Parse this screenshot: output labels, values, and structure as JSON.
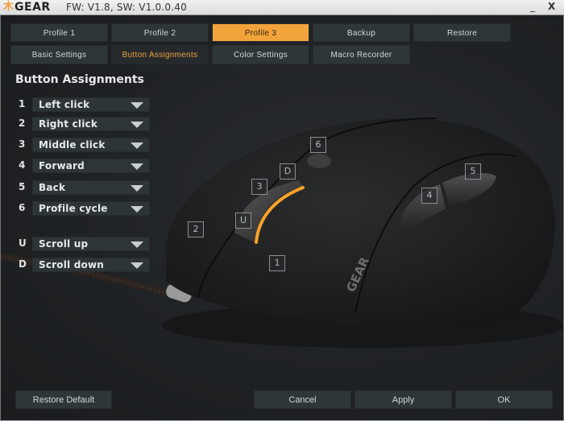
{
  "titlebar": {
    "logo_mark": "⽊",
    "logo_text": "GEAR",
    "version": "FW: V1.8, SW: V1.0.0.40",
    "minimize_label": "_",
    "close_label": "X"
  },
  "profile_tabs": [
    {
      "label": "Profile 1",
      "active": false
    },
    {
      "label": "Profile 2",
      "active": false
    },
    {
      "label": "Profile 3",
      "active": true
    },
    {
      "label": "Backup",
      "active": false
    },
    {
      "label": "Restore",
      "active": false
    }
  ],
  "section_tabs": [
    {
      "label": "Basic Settings",
      "active": false
    },
    {
      "label": "Button Assignments",
      "active": true
    },
    {
      "label": "Color Settings",
      "active": false
    },
    {
      "label": "Macro Recorder",
      "active": false
    }
  ],
  "section_title": "Button Assignments",
  "assignments": [
    {
      "key": "1",
      "value": "Left click"
    },
    {
      "key": "2",
      "value": "Right click"
    },
    {
      "key": "3",
      "value": "Middle click"
    },
    {
      "key": "4",
      "value": "Forward"
    },
    {
      "key": "5",
      "value": "Back"
    },
    {
      "key": "6",
      "value": "Profile cycle"
    },
    {
      "key": "U",
      "value": "Scroll up"
    },
    {
      "key": "D",
      "value": "Scroll down"
    }
  ],
  "mouse_markers": [
    "1",
    "2",
    "3",
    "4",
    "5",
    "6",
    "U",
    "D"
  ],
  "mouse_brand": "GEAR",
  "footer": {
    "restore_default": "Restore Default",
    "cancel": "Cancel",
    "apply": "Apply",
    "ok": "OK"
  },
  "colors": {
    "accent": "#f3a33b",
    "active_subtab_text": "#f1a041",
    "scroll_glow": "#f7a22a"
  }
}
